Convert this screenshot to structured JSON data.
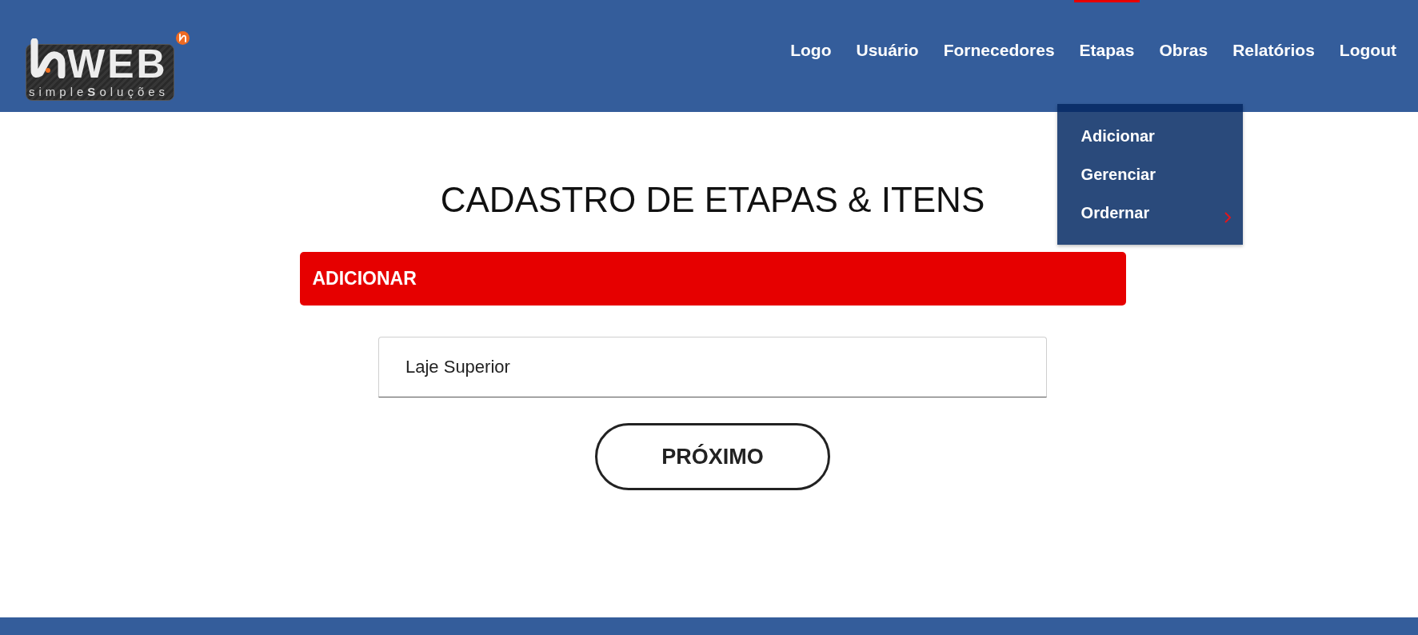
{
  "header": {
    "logo": {
      "wordmark": "WEB",
      "tagline": "simple**S**oluções"
    },
    "nav": [
      {
        "label": "Logo",
        "selected": false
      },
      {
        "label": "Usuário",
        "selected": false
      },
      {
        "label": "Fornecedores",
        "selected": false
      },
      {
        "label": "Etapas",
        "selected": true,
        "dropdown": [
          {
            "label": "Adicionar",
            "has_submenu": false
          },
          {
            "label": "Gerenciar",
            "has_submenu": false
          },
          {
            "label": "Ordernar",
            "has_submenu": true
          }
        ]
      },
      {
        "label": "Obras",
        "selected": false
      },
      {
        "label": "Relatórios",
        "selected": false
      },
      {
        "label": "Logout",
        "selected": false
      }
    ]
  },
  "main": {
    "title": "CADASTRO DE ETAPAS & ITENS",
    "section": {
      "title": "ADICIONAR"
    },
    "field": {
      "value": "Laje Superior"
    },
    "button": {
      "label": "PRÓXIMO"
    }
  }
}
